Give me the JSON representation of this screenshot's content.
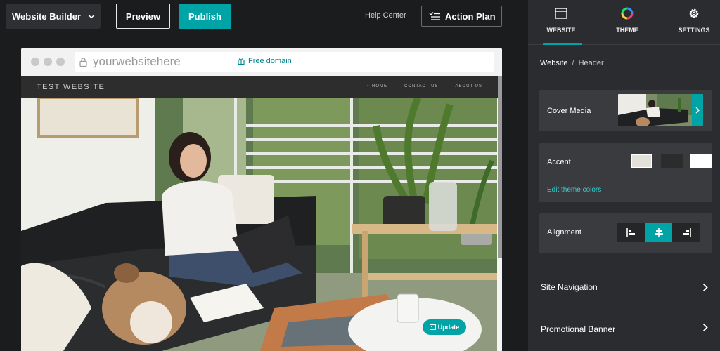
{
  "topbar": {
    "builder_label": "Website Builder",
    "preview_label": "Preview",
    "publish_label": "Publish",
    "help_label": "Help Center",
    "action_plan_label": "Action Plan"
  },
  "browser": {
    "url": "yourwebsitehere",
    "free_domain": "Free domain"
  },
  "site": {
    "title": "TEST WEBSITE",
    "nav": [
      "~ HOME",
      "CONTACT US",
      "ABOUT US"
    ],
    "update_label": "Update"
  },
  "panel": {
    "tabs": [
      {
        "label": "WEBSITE",
        "icon": "browser-window-icon",
        "active": true
      },
      {
        "label": "THEME",
        "icon": "color-wheel-icon",
        "active": false
      },
      {
        "label": "SETTINGS",
        "icon": "gear-icon",
        "active": false
      }
    ],
    "breadcrumb": {
      "root": "Website",
      "separator": "/",
      "current": "Header"
    },
    "cover_media_label": "Cover Media",
    "accent": {
      "label": "Accent",
      "swatches": [
        "#e3e0da",
        "#2c2c2c",
        "#ffffff"
      ],
      "edit_label": "Edit theme colors"
    },
    "alignment": {
      "label": "Alignment",
      "options": [
        "align-left-icon",
        "align-center-icon",
        "align-right-icon"
      ],
      "selected": "center"
    },
    "rows": [
      {
        "label": "Site Navigation"
      },
      {
        "label": "Promotional Banner"
      }
    ]
  },
  "colors": {
    "accent": "#00a4a6",
    "panel_bg": "#2b2c2f",
    "card_bg": "#3a3b3e"
  }
}
